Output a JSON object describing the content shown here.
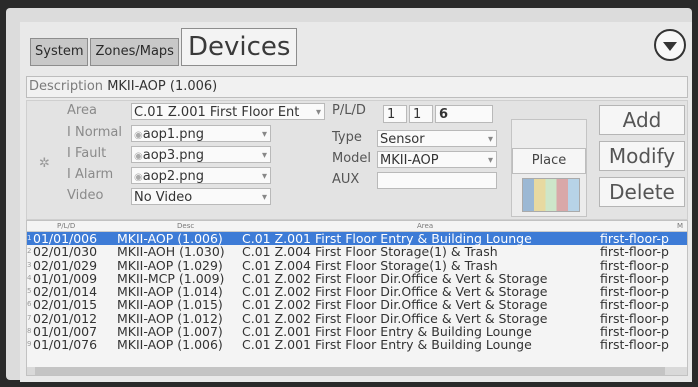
{
  "tabs": [
    {
      "label": "System"
    },
    {
      "label": "Zones/Maps"
    },
    {
      "label": "Devices"
    }
  ],
  "description": {
    "label": "Description",
    "value": "MKII-AOP (1.006)"
  },
  "form": {
    "area": {
      "label": "Area",
      "value": "C.01 Z.001 First Floor Ent"
    },
    "normal": {
      "label": "I Normal",
      "value": "aop1.png"
    },
    "fault": {
      "label": "I Fault",
      "value": "aop3.png"
    },
    "alarm": {
      "label": "I Alarm",
      "value": "aop2.png"
    },
    "video": {
      "label": "Video",
      "value": "No Video"
    },
    "pld": {
      "label": "P/L/D",
      "p": "1",
      "l": "1",
      "d": "6"
    },
    "type": {
      "label": "Type",
      "value": "Sensor"
    },
    "model": {
      "label": "Model",
      "value": "MKII-AOP"
    },
    "aux": {
      "label": "AUX",
      "value": ""
    }
  },
  "buttons": {
    "place": "Place",
    "add": "Add",
    "modify": "Modify",
    "delete": "Delete"
  },
  "table": {
    "headers": {
      "pld": "P/L/D",
      "desc": "Desc",
      "area": "Area",
      "map": "M"
    },
    "rows": [
      {
        "n": "1",
        "pld": "01/01/006",
        "desc": "MKII-AOP (1.006)",
        "area": "C.01 Z.001 First Floor Entry & Building Lounge",
        "map": "first-floor-p"
      },
      {
        "n": "2",
        "pld": "02/01/030",
        "desc": "MKII-AOH (1.030)",
        "area": "C.01 Z.004 First Floor Storage(1) & Trash",
        "map": "first-floor-p"
      },
      {
        "n": "3",
        "pld": "02/01/029",
        "desc": "MKII-AOP (1.029)",
        "area": "C.01 Z.004 First Floor Storage(1) & Trash",
        "map": "first-floor-p"
      },
      {
        "n": "4",
        "pld": "01/01/009",
        "desc": "MKII-MCP (1.009)",
        "area": "C.01 Z.002 First Floor Dir.Office & Vert & Storage",
        "map": "first-floor-p"
      },
      {
        "n": "5",
        "pld": "02/01/014",
        "desc": "MKII-AOP (1.014)",
        "area": "C.01 Z.002 First Floor Dir.Office & Vert & Storage",
        "map": "first-floor-p"
      },
      {
        "n": "6",
        "pld": "02/01/015",
        "desc": "MKII-AOP (1.015)",
        "area": "C.01 Z.002 First Floor Dir.Office & Vert & Storage",
        "map": "first-floor-p"
      },
      {
        "n": "7",
        "pld": "02/01/012",
        "desc": "MKII-AOP (1.012)",
        "area": "C.01 Z.002 First Floor Dir.Office & Vert & Storage",
        "map": "first-floor-p"
      },
      {
        "n": "8",
        "pld": "01/01/007",
        "desc": "MKII-AOP (1.007)",
        "area": "C.01 Z.001 First Floor Entry & Building Lounge",
        "map": "first-floor-p"
      },
      {
        "n": "9",
        "pld": "01/01/076",
        "desc": "MKII-AOP (1.006)",
        "area": "C.01 Z.001 First Floor Entry & Building Lounge",
        "map": "first-floor-p"
      }
    ]
  },
  "icons": {
    "menu": "chevron-down-circle-icon",
    "gear": "gear-icon"
  }
}
